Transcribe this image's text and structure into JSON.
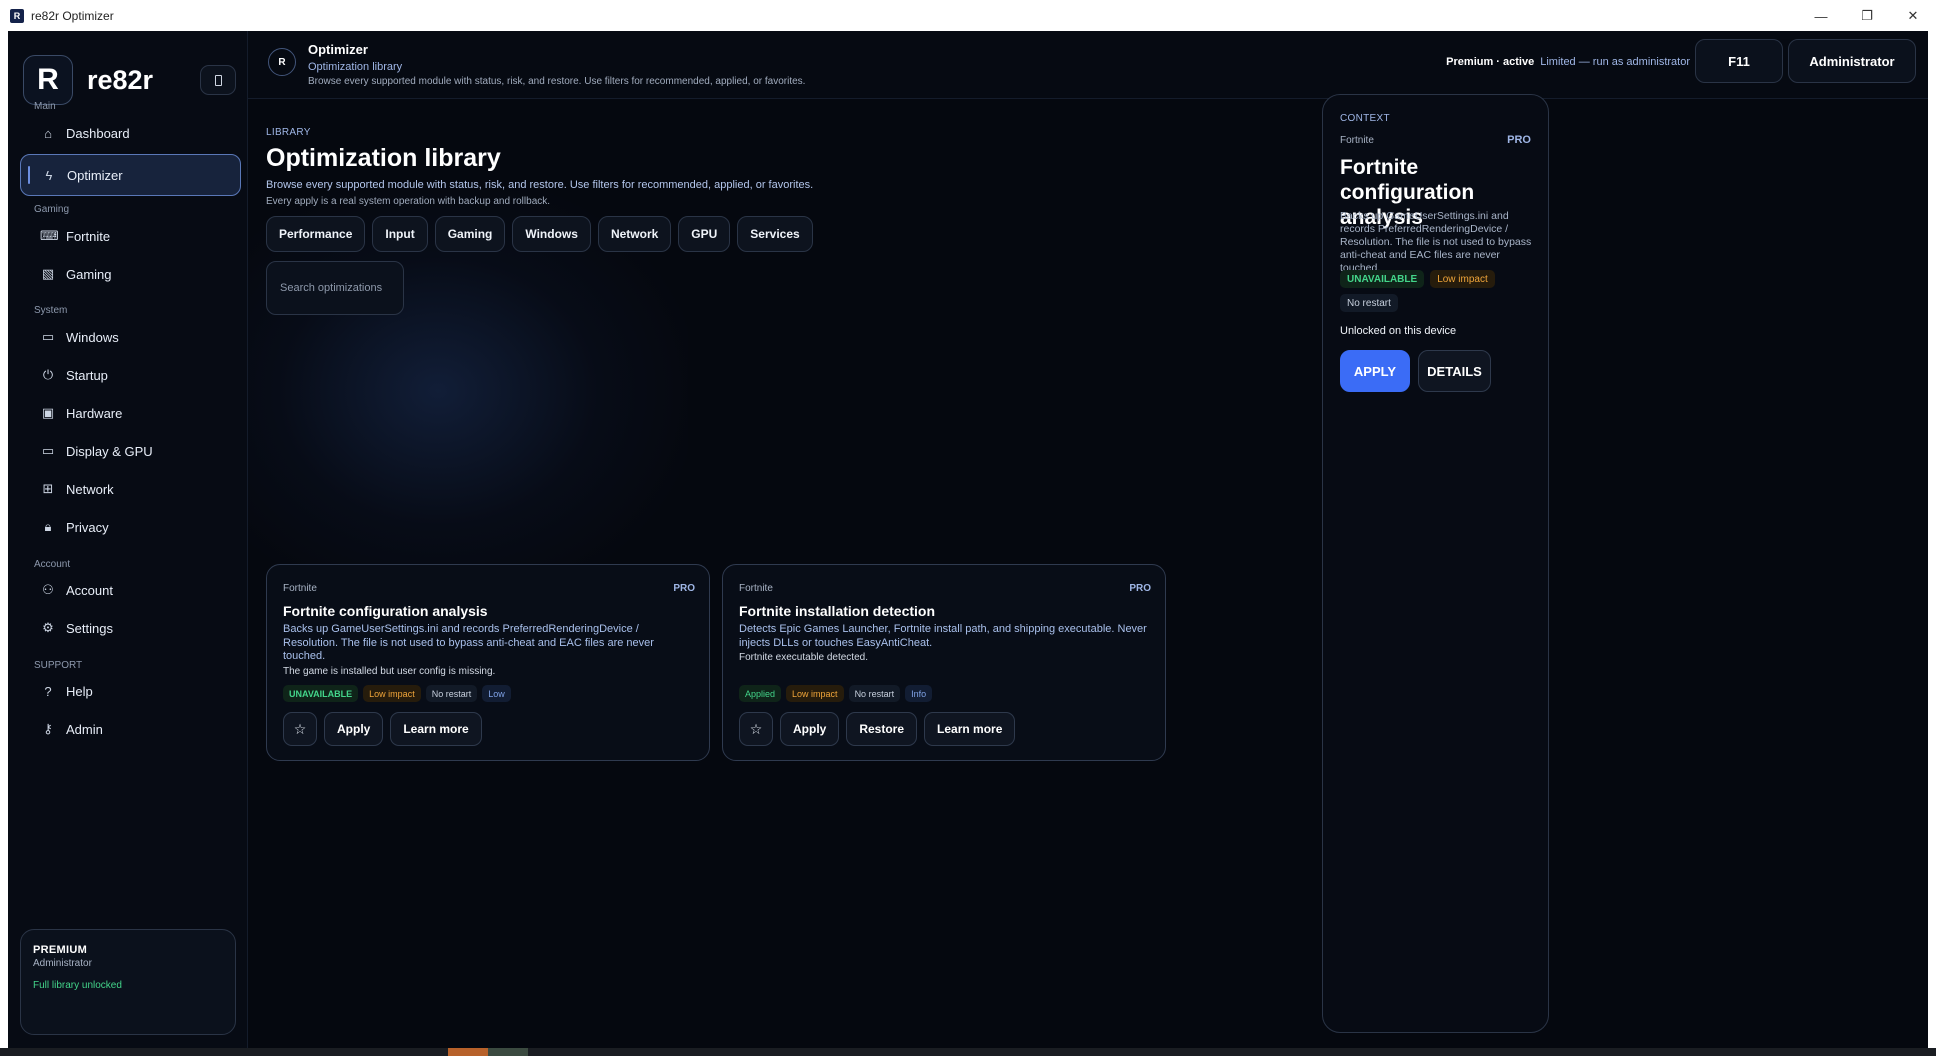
{
  "window": {
    "title": "re82r Optimizer",
    "icon_letter": "R",
    "minimize_glyph": "—",
    "restore_glyph": "❐",
    "close_glyph": "✕"
  },
  "brand": {
    "logo_letter": "R",
    "name": "re82r"
  },
  "sidebar": {
    "sections": {
      "main": "Main",
      "gaming": "Gaming",
      "system": "System",
      "account": "Account",
      "support": "SUPPORT"
    },
    "items": [
      {
        "label": "Dashboard",
        "icon": "home-icon"
      },
      {
        "label": "Optimizer",
        "icon": "bolt-icon",
        "active": true
      },
      {
        "label": "Fortnite",
        "icon": "gamepad-icon"
      },
      {
        "label": "Gaming",
        "icon": "chart-icon"
      },
      {
        "label": "Windows",
        "icon": "laptop-icon"
      },
      {
        "label": "Startup",
        "icon": "power-icon"
      },
      {
        "label": "Hardware",
        "icon": "chip-icon"
      },
      {
        "label": "Display & GPU",
        "icon": "monitor-icon"
      },
      {
        "label": "Network",
        "icon": "network-icon"
      },
      {
        "label": "Privacy",
        "icon": "lock-icon"
      },
      {
        "label": "Account",
        "icon": "user-icon"
      },
      {
        "label": "Settings",
        "icon": "gear-icon"
      },
      {
        "label": "Help",
        "icon": "question-icon"
      },
      {
        "label": "Admin",
        "icon": "key-icon"
      }
    ],
    "premium_card": {
      "title": "PREMIUM",
      "role": "Administrator",
      "status": "Full library unlocked"
    }
  },
  "header": {
    "logo_letter": "R",
    "title": "Optimizer",
    "subtitle": "Optimization library",
    "description": "Browse every supported module with status, risk, and restore. Use filters for recommended, applied, or favorites.",
    "premium_status": "Premium · active",
    "limited_status": "Limited — run as administrator",
    "f11_label": "F11",
    "admin_label": "Administrator"
  },
  "library": {
    "label": "LIBRARY",
    "title": "Optimization library",
    "description": "Browse every supported module with status, risk, and restore. Use filters for recommended, applied, or favorites.",
    "note": "Every apply is a real system operation with backup and rollback.",
    "filters": [
      "Performance",
      "Input",
      "Gaming",
      "Windows",
      "Network",
      "GPU",
      "Services"
    ],
    "search_placeholder": "Search optimizations"
  },
  "cards": [
    {
      "category": "Fortnite",
      "tier": "PRO",
      "title": "Fortnite configuration analysis",
      "description": "Backs up GameUserSettings.ini and records PreferredRenderingDevice / Resolution. The file is not used to bypass anti-cheat and EAC files are never touched.",
      "note": "The game is installed but user config is missing.",
      "tags": [
        "UNAVAILABLE",
        "Low impact",
        "No restart",
        "Low"
      ],
      "actions": {
        "star": "☆",
        "apply": "Apply",
        "learn": "Learn more"
      }
    },
    {
      "category": "Fortnite",
      "tier": "PRO",
      "title": "Fortnite installation detection",
      "description": "Detects Epic Games Launcher, Fortnite install path, and shipping executable. Never injects DLLs or touches EasyAntiCheat.",
      "note": "Fortnite executable detected.",
      "tags": [
        "Applied",
        "Low impact",
        "No restart",
        "Info"
      ],
      "actions": {
        "star": "☆",
        "apply": "Apply",
        "restore": "Restore",
        "learn": "Learn more"
      }
    }
  ],
  "context": {
    "label": "CONTEXT",
    "category": "Fortnite",
    "tier": "PRO",
    "title": "Fortnite configuration analysis",
    "description": "Backs up GameUserSettings.ini and records PreferredRenderingDevice / Resolution. The file is not used to bypass anti-cheat and EAC files are never touched.",
    "tags": [
      "UNAVAILABLE",
      "Low impact",
      "No restart"
    ],
    "unlocked": "Unlocked on this device",
    "apply_label": "APPLY",
    "details_label": "DETAILS"
  },
  "colors": {
    "accent": "#3b6cf6",
    "success": "#43d58a",
    "warning": "#f0a53a",
    "link": "#9fb6e6"
  }
}
